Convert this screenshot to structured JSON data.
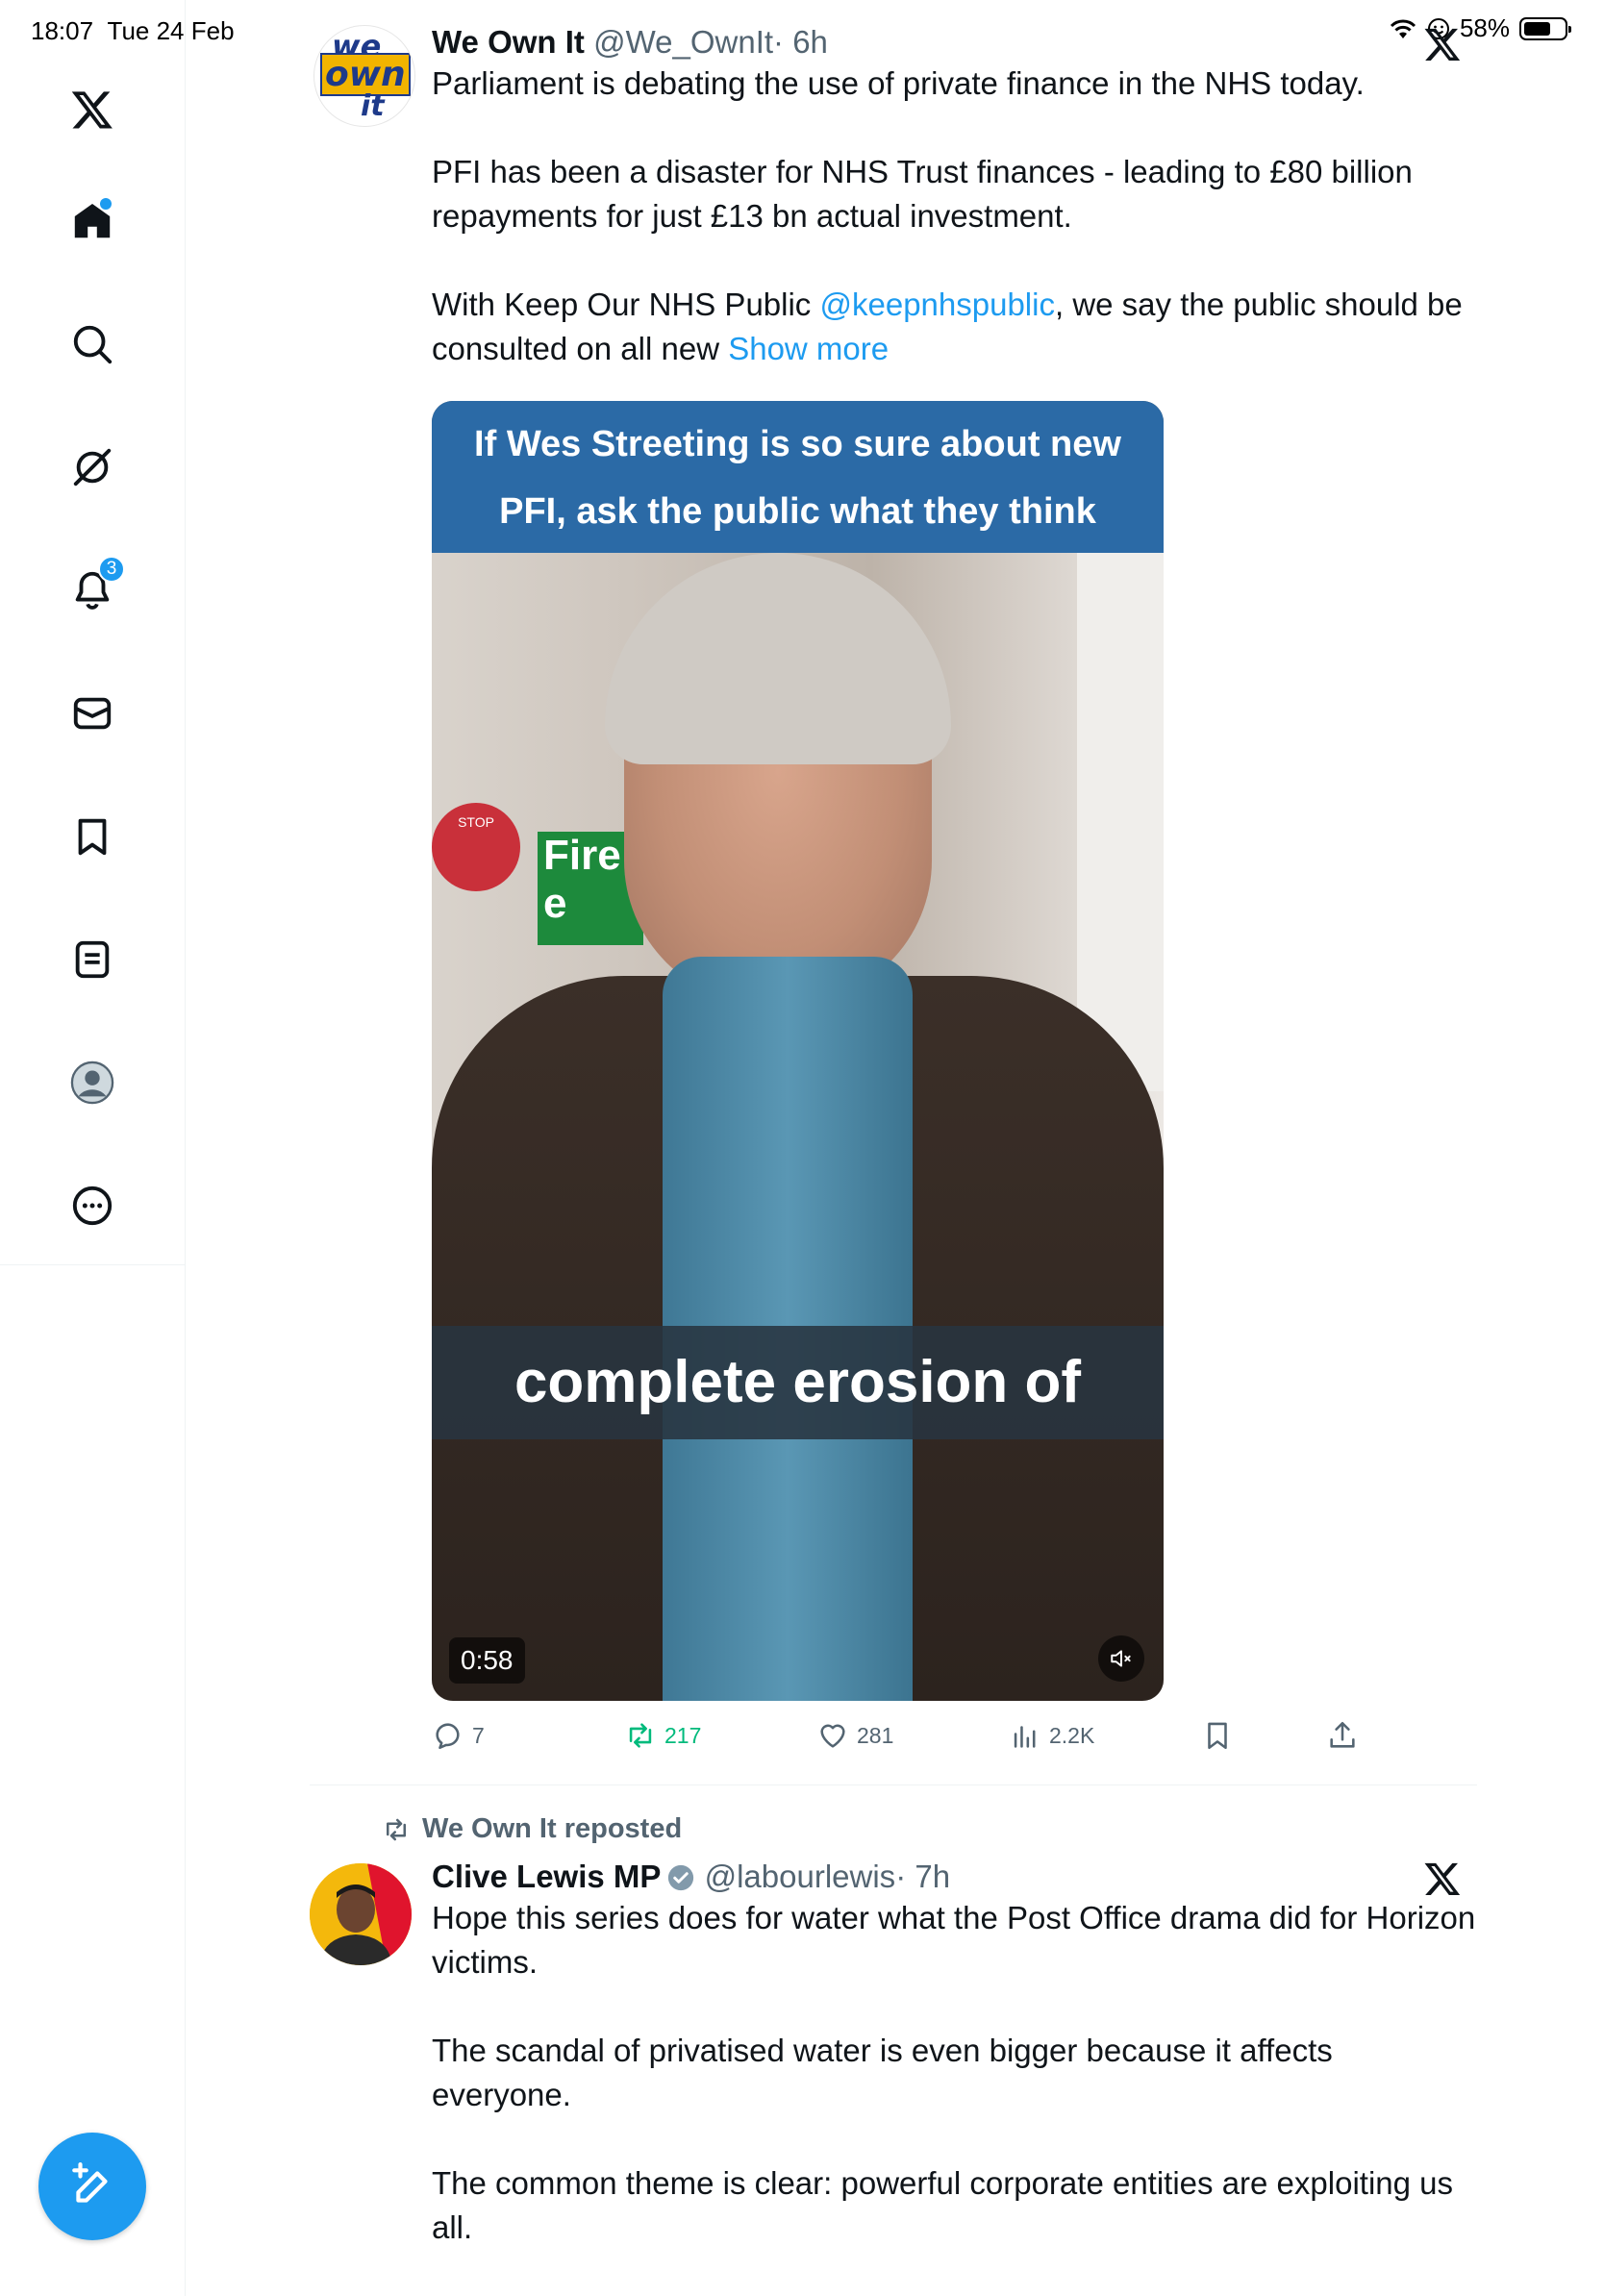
{
  "status_bar": {
    "time": "18:07",
    "date": "Tue 24 Feb",
    "battery": "58%"
  },
  "sidebar": {
    "logo": "x-logo-icon",
    "items": [
      {
        "name": "home",
        "icon": "home-icon",
        "has_dot": true
      },
      {
        "name": "explore",
        "icon": "search-icon"
      },
      {
        "name": "grok",
        "icon": "grok-icon"
      },
      {
        "name": "notifications",
        "icon": "bell-icon",
        "badge": "3"
      },
      {
        "name": "messages",
        "icon": "mail-icon"
      },
      {
        "name": "bookmarks",
        "icon": "bookmark-icon"
      },
      {
        "name": "lists",
        "icon": "list-icon"
      },
      {
        "name": "profile",
        "icon": "avatar-icon"
      },
      {
        "name": "more",
        "icon": "more-icon"
      }
    ],
    "compose_icon": "compose-icon",
    "accent": "#1d9bf0"
  },
  "tweet1": {
    "avatar_text": {
      "line1": "we",
      "line2": "own",
      "line3": "it"
    },
    "name": "We Own It",
    "handle": "@We_OwnIt",
    "time": "· 6h",
    "text": {
      "p1": "Parliament is debating the use of private finance in the NHS today.",
      "p2": "PFI has been a disaster for NHS Trust finances - leading to £80 billion repayments for just £13 bn actual investment.",
      "p3_before": "With Keep Our NHS Public ",
      "p3_mention": "@keepnhspublic",
      "p3_after": ", we say the public should be consulted on all new ",
      "show_more": "Show more"
    },
    "media": {
      "banner_line1": "If Wes Streeting is so sure about new",
      "banner_line2": "PFI, ask the public what they think",
      "caption": "complete erosion of",
      "stop_sign": "STOP",
      "fire_sign": "Fire e",
      "duration": "0:58"
    },
    "actions": {
      "replies": "7",
      "reposts": "217",
      "likes": "281",
      "views": "2.2K"
    }
  },
  "tweet2": {
    "repost_label": "We Own It reposted",
    "name": "Clive Lewis MP",
    "handle": "@labourlewis",
    "time": "· 7h",
    "text": {
      "p1": "Hope this series does for water what the Post Office drama did for Horizon victims.",
      "p2": "The scandal of privatised water is even bigger because it affects everyone.",
      "p3": "The common theme is clear: powerful corporate entities are exploiting us all."
    }
  }
}
